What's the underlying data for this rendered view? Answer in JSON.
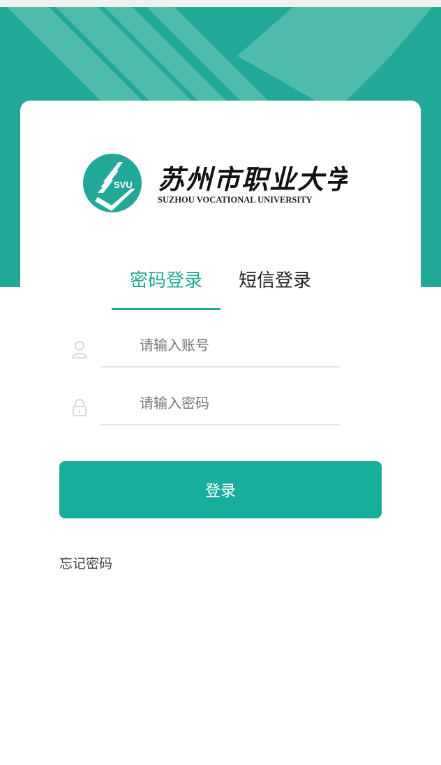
{
  "brand": {
    "name_cn": "苏州市职业大学",
    "name_en": "SUZHOU VOCATIONAL UNIVERSITY",
    "emblem_text": "SVU",
    "color": "#21a896"
  },
  "tabs": [
    {
      "label": "密码登录",
      "active": true
    },
    {
      "label": "短信登录",
      "active": false
    }
  ],
  "form": {
    "account_placeholder": "请输入账号",
    "password_placeholder": "请输入密码",
    "account_icon": "user-icon",
    "password_icon": "lock-icon"
  },
  "actions": {
    "login_label": "登录",
    "forgot_label": "忘记密码"
  },
  "colors": {
    "accent": "#21a896",
    "button": "#17af9b"
  }
}
